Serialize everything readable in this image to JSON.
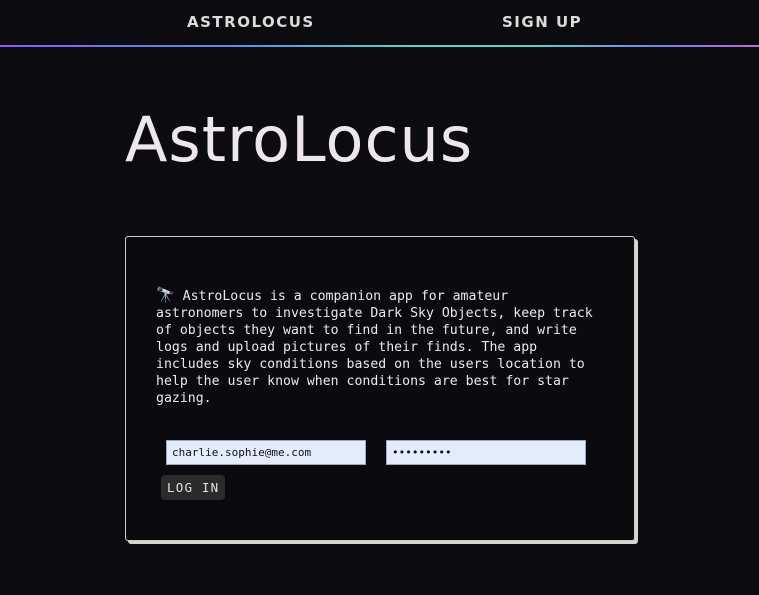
{
  "nav": {
    "home_label": "ASTROLOCUS",
    "signup_label": "SIGN UP"
  },
  "main": {
    "title": "AstroLocus",
    "about_icon": "🔭",
    "about_text": " AstroLocus is a companion app for amateur\nastronomers to investigate Dark Sky Objects, keep track\nof objects they want to find in the future, and write\nlogs and upload pictures of their finds. The app\nincludes sky conditions based on the users location to\nhelp the user know when conditions are best for star\ngazing."
  },
  "login": {
    "email_value": "charlie.sophie@me.com",
    "password_value": "password1",
    "button_label": "LOG IN"
  },
  "icons": {
    "about_icon": "telescope-icon"
  },
  "colors": {
    "background": "#0b0b10",
    "input_background": "#e2ecfb",
    "button_background": "#2b2b2e",
    "gradient_start": "#8b5cf6",
    "gradient_mid": "#5ed4c8",
    "gradient_end": "#c06ad8"
  }
}
